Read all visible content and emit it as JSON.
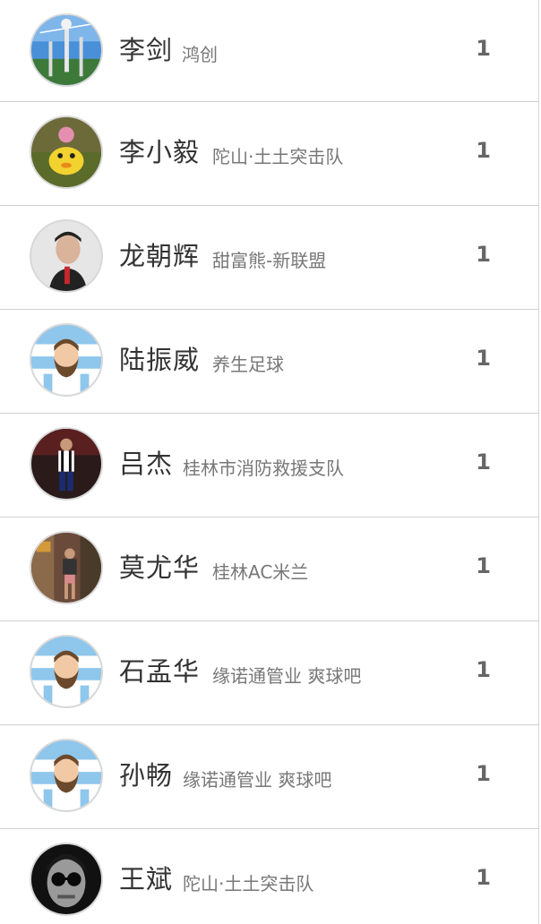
{
  "players": [
    {
      "name": "李剑",
      "team": "鸿创",
      "count": "1",
      "avatar_icon": "landscape-photo-icon"
    },
    {
      "name": "李小毅",
      "team": "陀山·土土突击队",
      "count": "1",
      "avatar_icon": "child-duck-toy-photo-icon"
    },
    {
      "name": "龙朝辉",
      "team": "甜富熊-新联盟",
      "count": "1",
      "avatar_icon": "man-portrait-photo-icon"
    },
    {
      "name": "陆振威",
      "team": "养生足球",
      "count": "1",
      "avatar_icon": "bearded-cartoon-avatar-icon"
    },
    {
      "name": "吕杰",
      "team": "桂林市消防救援支队",
      "count": "1",
      "avatar_icon": "soccer-player-photo-icon"
    },
    {
      "name": "莫尤华",
      "team": "桂林AC米兰",
      "count": "1",
      "avatar_icon": "street-photo-icon"
    },
    {
      "name": "石孟华",
      "team": "缘诺通管业 爽球吧",
      "count": "1",
      "avatar_icon": "bearded-cartoon-avatar-icon"
    },
    {
      "name": "孙畅",
      "team": "缘诺通管业 爽球吧",
      "count": "1",
      "avatar_icon": "bearded-cartoon-avatar-icon"
    },
    {
      "name": "王斌",
      "team": "陀山·土土突击队",
      "count": "1",
      "avatar_icon": "sunglasses-portrait-icon"
    }
  ],
  "colors": {
    "name_text": "#333333",
    "team_text": "#777777",
    "count_text": "#666666",
    "divider": "#d0d0d0",
    "jersey_blue": "#8fc6ec"
  }
}
